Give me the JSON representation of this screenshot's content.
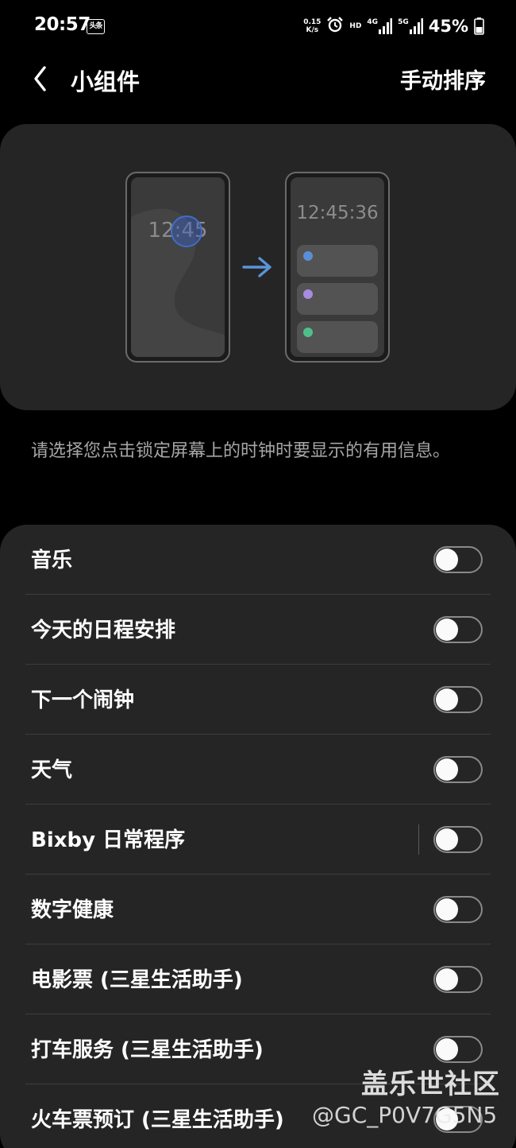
{
  "status_bar": {
    "time": "20:57",
    "app_badge": "头条",
    "net_speed_value": "0.15",
    "net_speed_unit": "K/s",
    "hd_label": "HD",
    "network_4g": "4G",
    "network_5g": "5G",
    "battery_percent": "45%"
  },
  "app_bar": {
    "title": "小组件",
    "action": "手动排序"
  },
  "preview": {
    "before_time": "12:45",
    "after_time": "12:45:36",
    "widget_colors": [
      "#5b8dd9",
      "#a98be0",
      "#4fbf8a"
    ]
  },
  "description": "请选择您点击锁定屏幕上的时钟时要显示的有用信息。",
  "settings": [
    {
      "label": "音乐",
      "enabled": false
    },
    {
      "label": "今天的日程安排",
      "enabled": false
    },
    {
      "label": "下一个闹钟",
      "enabled": false
    },
    {
      "label": "天气",
      "enabled": false
    },
    {
      "label": "Bixby 日常程序",
      "enabled": false
    },
    {
      "label": "数字健康",
      "enabled": false
    },
    {
      "label": "电影票 (三星生活助手)",
      "enabled": false
    },
    {
      "label": "打车服务 (三星生活助手)",
      "enabled": false
    },
    {
      "label": "火车票预订 (三星生活助手)",
      "enabled": false
    }
  ],
  "watermark": {
    "brand": "盖乐世社区",
    "user": "@GC_P0V7G5N5"
  },
  "colors": {
    "background": "#000000",
    "card": "#252525",
    "accent_arrow": "#5b93d9"
  }
}
